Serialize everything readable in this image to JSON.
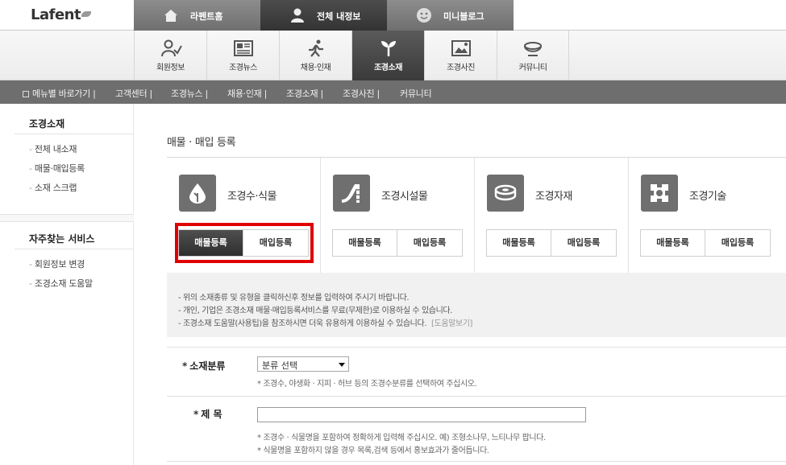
{
  "brand": {
    "logo_text": "Lafent"
  },
  "top_tabs": [
    {
      "label": "라펜트홈",
      "icon": "home-icon"
    },
    {
      "label": "전체 내정보",
      "icon": "person-icon",
      "active": true
    },
    {
      "label": "미니블로그",
      "icon": "smiley-icon"
    }
  ],
  "main_nav": [
    {
      "label": "회원정보",
      "icon": "member-icon"
    },
    {
      "label": "조경뉴스",
      "icon": "newspaper-icon"
    },
    {
      "label": "채용·인재",
      "icon": "runner-icon"
    },
    {
      "label": "조경소재",
      "icon": "sprout-icon",
      "active": true
    },
    {
      "label": "조경사진",
      "icon": "photo-icon"
    },
    {
      "label": "커뮤니티",
      "icon": "cup-icon"
    }
  ],
  "sub_bar": {
    "items": [
      "메뉴별 바로가기 |",
      "고객센터 |",
      "조경뉴스 |",
      "채용·인재 |",
      "조경소재 |",
      "조경사진 |",
      "커뮤니티"
    ]
  },
  "sidebar": {
    "section1_title": "조경소재",
    "section1_links": [
      "전체 내소재",
      "매물·매입등록",
      "소재 스크랩"
    ],
    "section2_title": "자주찾는 서비스",
    "section2_links": [
      "회원정보 변경",
      "조경소재 도움말"
    ]
  },
  "page_title": "매물 · 매입 등록",
  "categories": [
    {
      "name": "조경수·식물",
      "icon": "drop-leaf-icon",
      "sell_label": "매물등록",
      "buy_label": "매입등록",
      "selected": "sell"
    },
    {
      "name": "조경시설물",
      "icon": "slide-icon",
      "sell_label": "매물등록",
      "buy_label": "매입등록"
    },
    {
      "name": "조경자재",
      "icon": "roll-icon",
      "sell_label": "매물등록",
      "buy_label": "매입등록"
    },
    {
      "name": "조경기술",
      "icon": "gear-icon",
      "sell_label": "매물등록",
      "buy_label": "매입등록"
    }
  ],
  "notice": {
    "lines": [
      "- 위의 소재종류 및 유형을 클릭하신후 정보를 입력하여 주시기 바랍니다.",
      "- 개인, 기업은 조경소재 매물·매입등록서비스를 무료(무제한)로 이용하실 수 있습니다.",
      "- 조경소재 도움말(사용팁)을 참조하시면 더욱 유용하게 이용하실 수 있습니다."
    ],
    "help_link": "[도움말보기]"
  },
  "form": {
    "category_label": "소재분류",
    "category_select_value": "분류 선택",
    "category_hint": "* 조경수, 야생화 · 지피 · 허브 등의 조경수분류를 선택하여 주십시오.",
    "title_label": "제 목",
    "title_value": "",
    "title_hint1": "* 조경수 · 식물명을 포함하여 정확하게 입력해 주십시오. 예) 조형소나무, 느티나무 팝니다.",
    "title_hint2": "* 식물명을 포함하지 않을 경우 목록,검색 등에서 홍보효과가 줄어듭니다."
  },
  "colors": {
    "highlight": "#e00000",
    "nav_active": "#3a3a3a",
    "sub_bar": "#6e6e6e"
  }
}
